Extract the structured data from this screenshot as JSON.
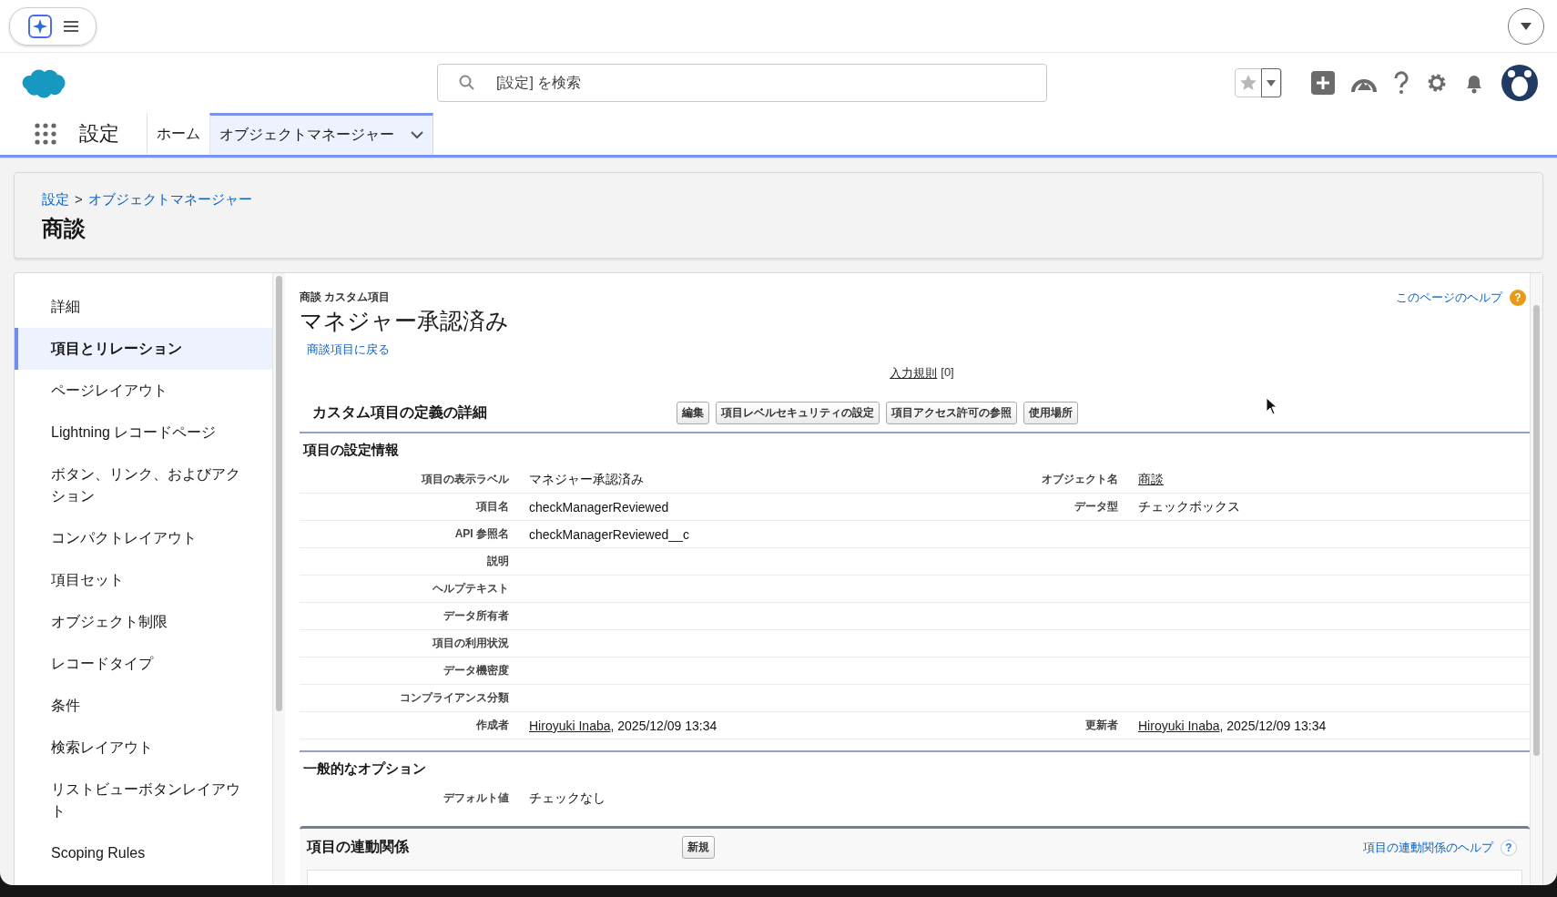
{
  "search": {
    "placeholder": "[設定] を検索"
  },
  "app_name": "設定",
  "tabs": [
    {
      "label": "ホーム",
      "selected": false,
      "dropdown": false
    },
    {
      "label": "オブジェクトマネージャー",
      "selected": true,
      "dropdown": true
    }
  ],
  "breadcrumb": [
    {
      "label": "設定"
    },
    {
      "label": "オブジェクトマネージャー"
    }
  ],
  "breadcrumb_separator": ">",
  "page_title": "商談",
  "sidebar": {
    "items": [
      {
        "label": "詳細",
        "selected": false
      },
      {
        "label": "項目とリレーション",
        "selected": true
      },
      {
        "label": "ページレイアウト",
        "selected": false
      },
      {
        "label": "Lightning レコードページ",
        "selected": false
      },
      {
        "label": "ボタン、リンク、およびアクション",
        "selected": false
      },
      {
        "label": "コンパクトレイアウト",
        "selected": false
      },
      {
        "label": "項目セット",
        "selected": false
      },
      {
        "label": "オブジェクト制限",
        "selected": false
      },
      {
        "label": "レコードタイプ",
        "selected": false
      },
      {
        "label": "条件",
        "selected": false
      },
      {
        "label": "検索レイアウト",
        "selected": false
      },
      {
        "label": "リストビューボタンレイアウト",
        "selected": false
      },
      {
        "label": "Scoping Rules",
        "selected": false
      }
    ]
  },
  "detail": {
    "subtitle": "商談 カスタム項目",
    "title": "マネジャー承認済み",
    "back_link": "商談項目に戻る",
    "help_link": "このページのヘルプ",
    "help_mark": "?",
    "related": {
      "link": "入力規則",
      "count": "[0]"
    },
    "section": {
      "title": "カスタム項目の定義の詳細",
      "buttons": [
        "編集",
        "項目レベルセキュリティの設定",
        "項目アクセス許可の参照",
        "使用場所"
      ]
    },
    "info_heading": "項目の設定情報",
    "rows": [
      {
        "label": "項目の表示ラベル",
        "value": [
          {
            "text": "マネジャー承認済み",
            "link": false
          }
        ],
        "label2": "オブジェクト名",
        "value2": [
          {
            "text": "商談",
            "link": true
          }
        ]
      },
      {
        "label": "項目名",
        "value": [
          {
            "text": "checkManagerReviewed",
            "link": false
          }
        ],
        "label2": "データ型",
        "value2": [
          {
            "text": "チェックボックス",
            "link": false
          }
        ]
      },
      {
        "label": "API 参照名",
        "value": [
          {
            "text": "checkManagerReviewed__c",
            "link": false
          }
        ]
      },
      {
        "label": "説明"
      },
      {
        "label": "ヘルプテキスト"
      },
      {
        "label": "データ所有者"
      },
      {
        "label": "項目の利用状況"
      },
      {
        "label": "データ機密度"
      },
      {
        "label": "コンプライアンス分類"
      },
      {
        "label": "作成者",
        "value": [
          {
            "text": "Hiroyuki Inaba",
            "link": true
          },
          {
            "text": ", 2025/12/09 13:34",
            "link": false
          }
        ],
        "label2": "更新者",
        "value2": [
          {
            "text": "Hiroyuki Inaba",
            "link": true
          },
          {
            "text": ", 2025/12/09 13:34",
            "link": false
          }
        ]
      }
    ],
    "options_heading": "一般的なオプション",
    "options": [
      {
        "label": "デフォルト値",
        "value": "チェックなし"
      }
    ],
    "dependency": {
      "title": "項目の連動関係",
      "button": "新規",
      "help_link": "項目の連動関係のヘルプ",
      "help_mark": "?"
    }
  }
}
